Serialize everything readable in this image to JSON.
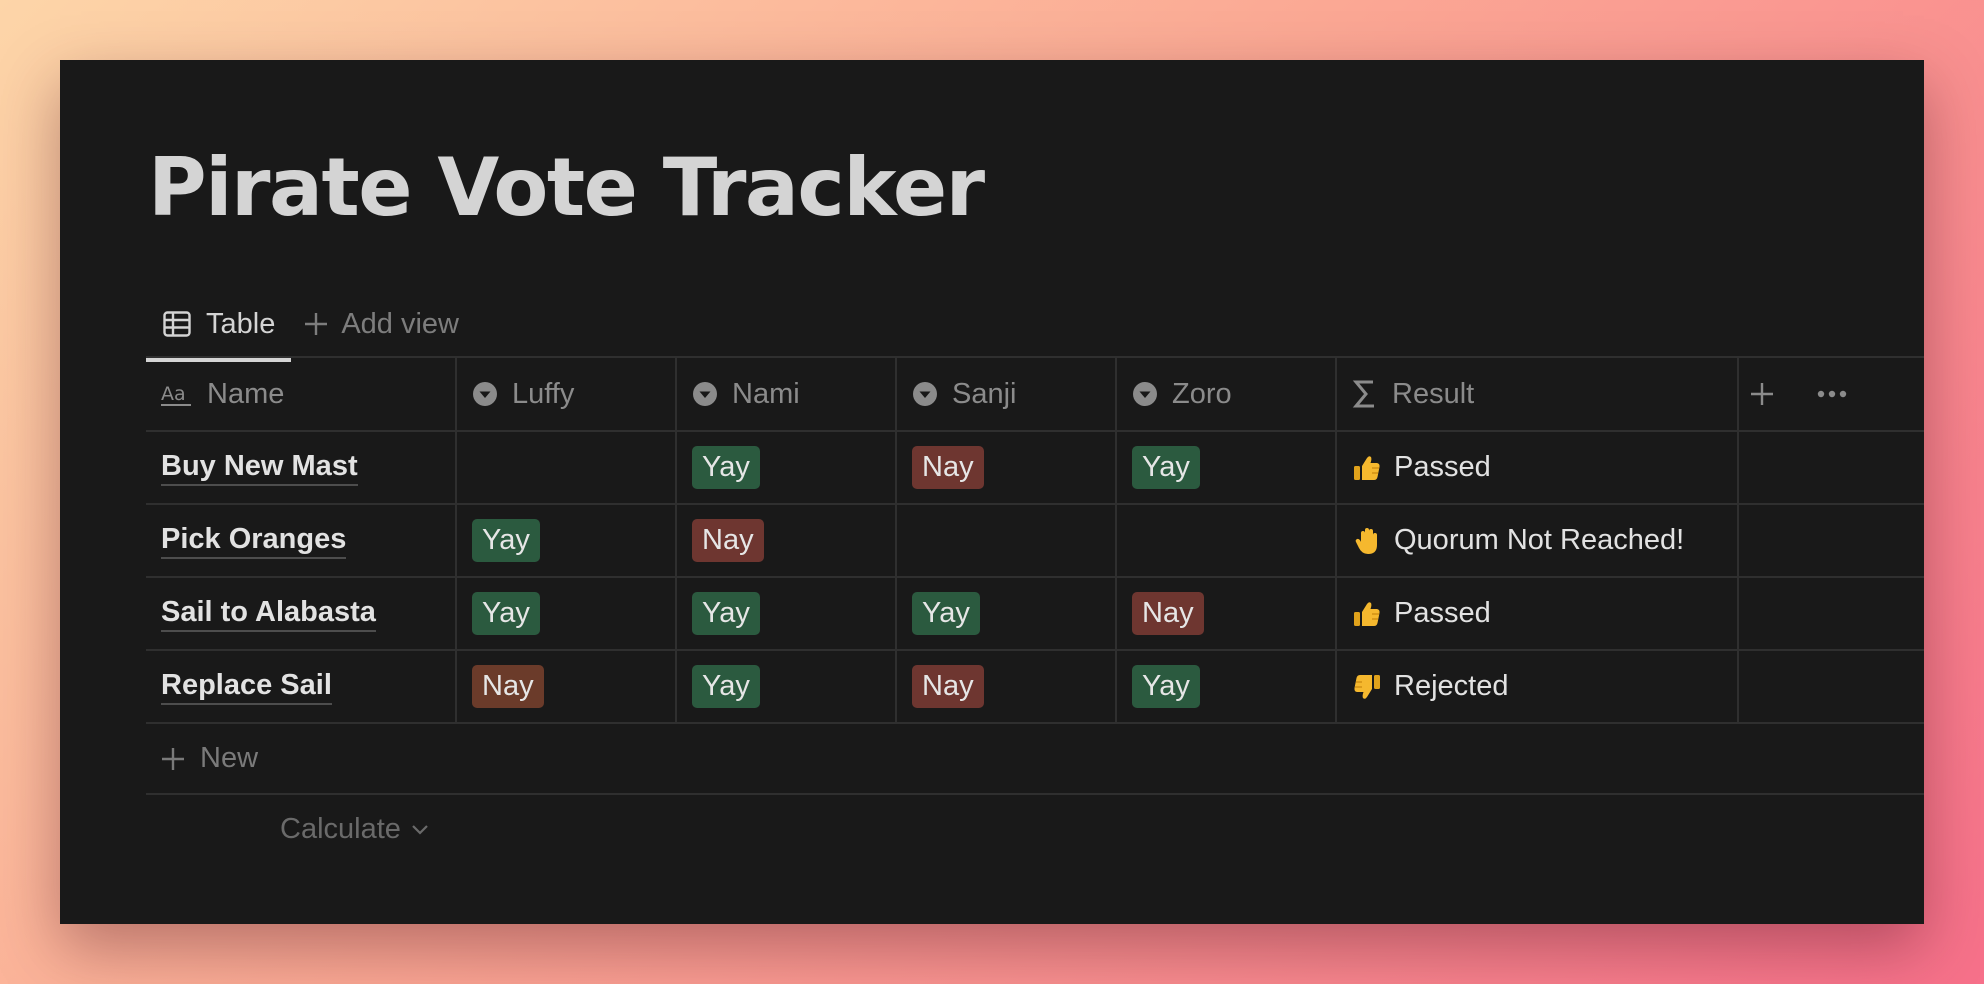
{
  "page": {
    "title": "Pirate Vote Tracker"
  },
  "views": {
    "active_tab": "Table",
    "active_tab_icon": "table-icon",
    "add_view_label": "Add view",
    "add_view_icon": "plus-icon"
  },
  "table": {
    "columns": [
      {
        "label": "Name",
        "icon": "text-property-icon"
      },
      {
        "label": "Luffy",
        "icon": "select-property-icon"
      },
      {
        "label": "Nami",
        "icon": "select-property-icon"
      },
      {
        "label": "Sanji",
        "icon": "select-property-icon"
      },
      {
        "label": "Zoro",
        "icon": "select-property-icon"
      },
      {
        "label": "Result",
        "icon": "formula-sigma-icon"
      }
    ],
    "header_actions": [
      "plus-icon",
      "more-dots-icon"
    ],
    "rows": [
      {
        "name": "Buy New Mast",
        "luffy": "",
        "nami": "Yay",
        "sanji": "Nay",
        "zoro": "Yay",
        "result_emoji": "thumbs-up-icon",
        "result": "Passed"
      },
      {
        "name": "Pick Oranges",
        "luffy": "Yay",
        "nami": "Nay",
        "sanji": "",
        "zoro": "",
        "result_emoji": "raised-hand-icon",
        "result": "Quorum Not Reached!"
      },
      {
        "name": "Sail to Alabasta",
        "luffy": "Yay",
        "nami": "Yay",
        "sanji": "Yay",
        "zoro": "Nay",
        "result_emoji": "thumbs-up-icon",
        "result": "Passed"
      },
      {
        "name": "Replace Sail",
        "luffy": "Nay",
        "nami": "Yay",
        "sanji": "Nay",
        "zoro": "Yay",
        "result_emoji": "thumbs-down-icon",
        "result": "Rejected"
      }
    ],
    "new_row_label": "New",
    "calculate_label": "Calculate"
  },
  "colors": {
    "background": "#191919",
    "yay_tag": "#2b5a3f",
    "nay_tag": "#6e3630",
    "text": "#d4d4d4"
  }
}
